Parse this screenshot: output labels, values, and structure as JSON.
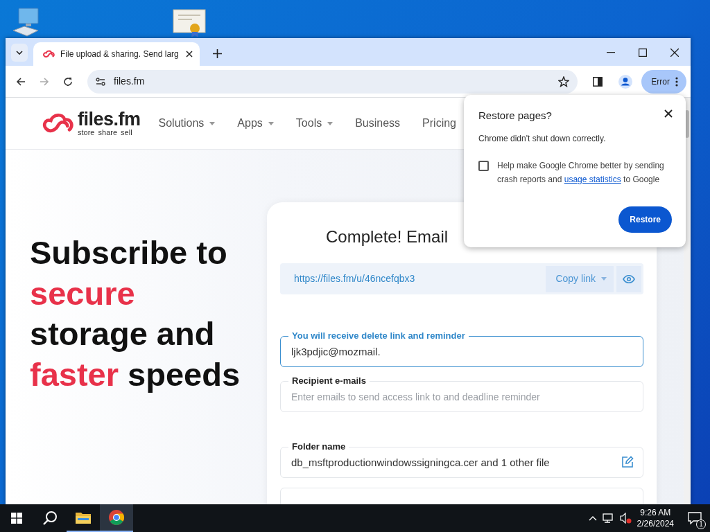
{
  "browser": {
    "tab": {
      "title": "File upload & sharing. Send larg",
      "selected": true
    },
    "address": "files.fm",
    "profile_button": "Error"
  },
  "site": {
    "logo": {
      "name": "files.fm",
      "tagline": "store  share  sell"
    },
    "nav": [
      {
        "label": "Solutions",
        "dropdown": true
      },
      {
        "label": "Apps",
        "dropdown": true
      },
      {
        "label": "Tools",
        "dropdown": true
      },
      {
        "label": "Business",
        "dropdown": false
      },
      {
        "label": "Pricing",
        "dropdown": false
      }
    ],
    "hero": [
      {
        "text": "Subscribe to",
        "accent": false
      },
      {
        "text": "secure",
        "accent": true
      },
      {
        "text": "storage and",
        "accent": false
      },
      {
        "text": "faster",
        "accent": true,
        "rest": " speeds"
      }
    ],
    "card": {
      "title": "Complete! Email",
      "link": "https://files.fm/u/46ncefqbx3",
      "copy_button": "Copy link",
      "fields": [
        {
          "label": "You will receive delete link and reminder",
          "value": "ljk3pdjic@mozmail.",
          "focused": true
        },
        {
          "label": "Recipient e-mails",
          "placeholder": "Enter emails to send access link to and deadline reminder",
          "focused": false
        },
        {
          "label": "Folder name",
          "value": "db_msftproductionwindowssigningca.cer and 1 other file",
          "focused": false,
          "editable": true
        },
        {
          "focused": false
        }
      ]
    }
  },
  "popup": {
    "title": "Restore pages?",
    "message": "Chrome didn't shut down correctly.",
    "consent": {
      "checked": false,
      "before": "Help make Google Chrome better by sending crash reports and",
      "link": "usage statistics",
      "after": "to Google"
    },
    "button": "Restore"
  },
  "taskbar": {
    "time": "9:26 AM",
    "date": "2/26/2024",
    "notifications": "1"
  }
}
